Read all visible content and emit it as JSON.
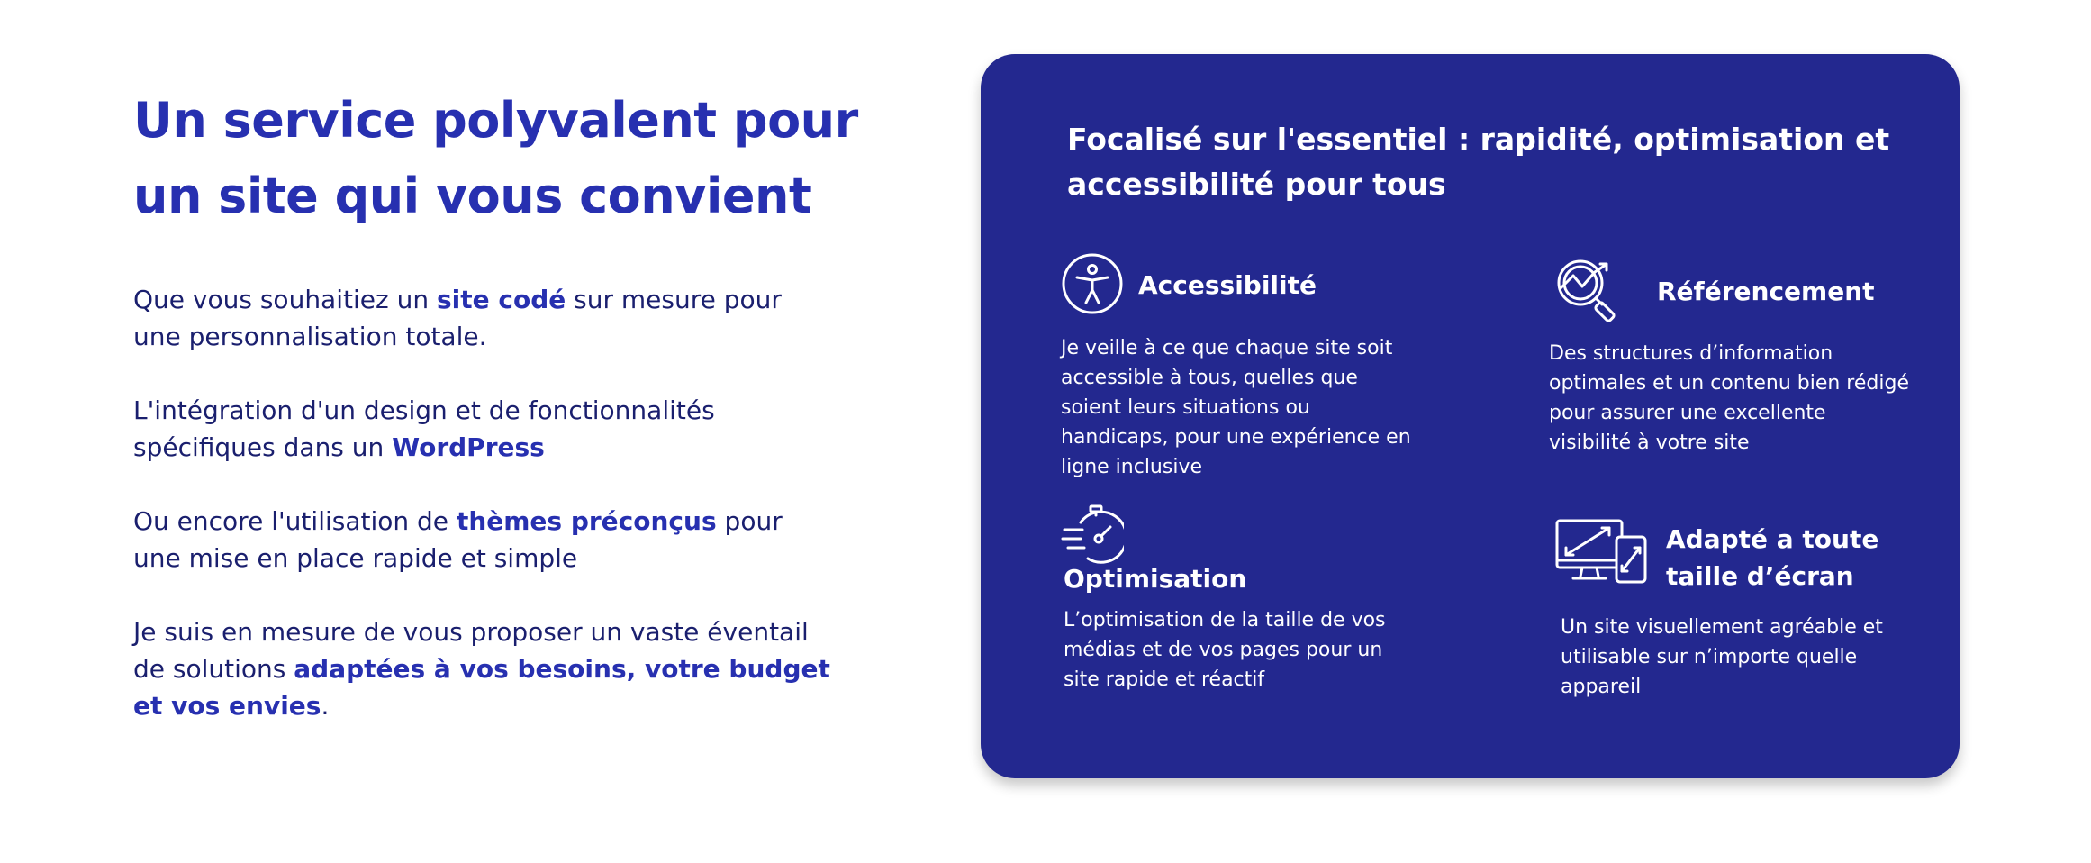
{
  "left": {
    "heading_line1": "Un service polyvalent pour",
    "heading_line2": "un site qui vous convient",
    "p1": {
      "before": "Que vous souhaitiez un ",
      "highlight": "site codé",
      "after": " sur mesure pour une personnalisation totale."
    },
    "p2": {
      "before": "L'intégration d'un design et de fonctionnalités spécifiques dans un ",
      "highlight": "WordPress",
      "after": ""
    },
    "p3": {
      "before": "Ou encore l'utilisation de ",
      "highlight": "thèmes préconçus",
      "after": " pour une mise en place rapide et simple"
    },
    "p4": {
      "before": "Je suis en mesure de vous proposer un vaste éventail de solutions ",
      "highlight": "adaptées à vos besoins, votre budget et vos envies",
      "after": "."
    }
  },
  "card": {
    "title": "Focalisé sur l'essentiel : rapidité, optimisation et accessibilité pour tous",
    "features": {
      "accessibility": {
        "title": "Accessibilité",
        "desc": "Je veille à ce que chaque site soit accessible à tous, quelles que soient leurs situations ou handicaps, pour une expérience en ligne inclusive",
        "icon": "accessibility-icon"
      },
      "seo": {
        "title": "Référencement",
        "desc": "Des structures d’information optimales et un contenu bien rédigé pour assurer une excellente visibilité à votre site",
        "icon": "seo-magnifier-chart-icon"
      },
      "optimization": {
        "title": "Optimisation",
        "desc": "L’optimisation de la taille de vos médias et de vos pages pour un site rapide et réactif",
        "icon": "stopwatch-speed-icon"
      },
      "responsive": {
        "title": "Adapté a toute taille d’écran",
        "desc": "Un site visuellement agréable et utilisable sur n’importe quelle appareil",
        "icon": "responsive-devices-icon"
      }
    }
  },
  "colors": {
    "primary": "#2730b0",
    "text_dark": "#1a1f6e",
    "card_bg": "#23288f",
    "card_text": "#ffffff"
  }
}
